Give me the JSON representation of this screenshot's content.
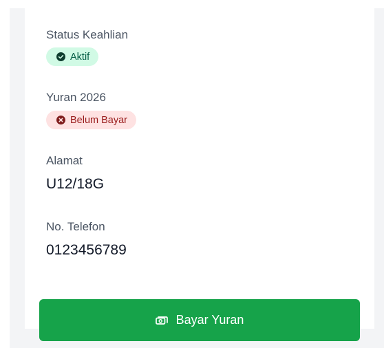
{
  "status": {
    "label": "Status Keahlian",
    "badge": "Aktif",
    "badge_icon": "check-circle-icon",
    "badge_color": "#065f46",
    "badge_bg": "#d1fae5"
  },
  "fee": {
    "label": "Yuran 2026",
    "badge": "Belum Bayar",
    "badge_icon": "x-circle-icon",
    "badge_color": "#991b1b",
    "badge_bg": "#fee2e2"
  },
  "address": {
    "label": "Alamat",
    "value": "U12/18G"
  },
  "phone": {
    "label": "No. Telefon",
    "value": "0123456789"
  },
  "pay_button": {
    "label": "Bayar Yuran",
    "icon": "money-icon",
    "color": "#16a34a"
  }
}
